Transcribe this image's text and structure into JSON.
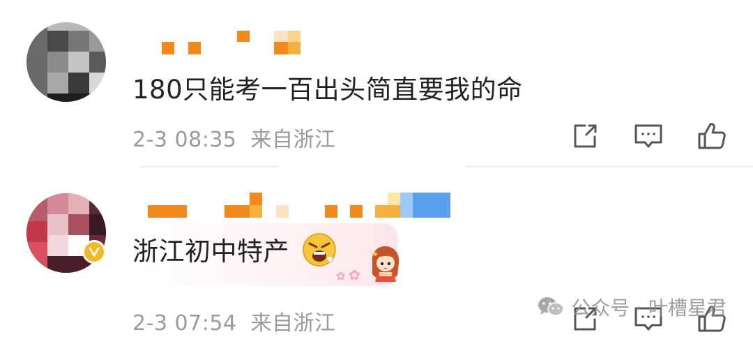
{
  "comments": [
    {
      "text": "180只能考一百出头简直要我的命",
      "timestamp": "2-3 08:35",
      "location": "来自浙江",
      "verified": false
    },
    {
      "text": "浙江初中特产",
      "timestamp": "2-3 07:54",
      "location": "来自浙江",
      "verified": true,
      "emoji": "angry-face-sticker",
      "badge_sticker": "anime-girl-sticker"
    }
  ],
  "actions": [
    "share-icon",
    "reply-icon",
    "like-icon"
  ],
  "watermark": {
    "icon": "wechat-icon",
    "text": "公众号 · 叶槽星君"
  },
  "colors": {
    "text": "#222222",
    "meta": "#9a9a9a",
    "icon": "#555555",
    "username_orange": "#f08a1c",
    "verified_badge": "#f5b823"
  }
}
